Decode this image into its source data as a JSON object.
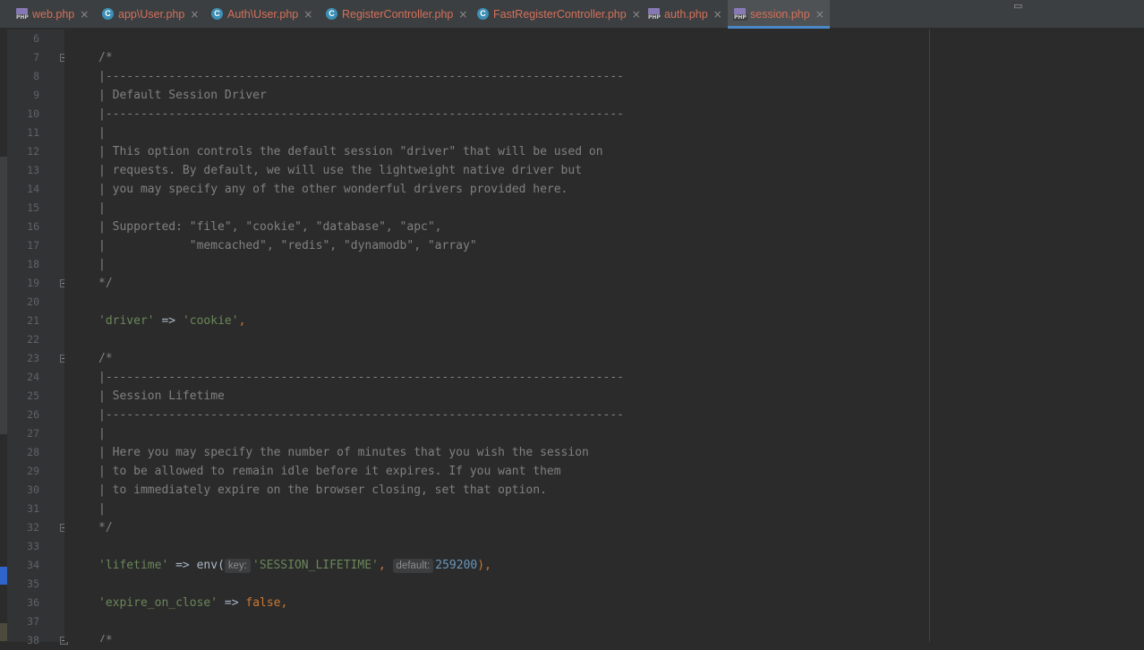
{
  "tabs": [
    {
      "label": "web.php",
      "icon": "php-file-icon"
    },
    {
      "label": "app\\User.php",
      "icon": "class-icon"
    },
    {
      "label": "Auth\\User.php",
      "icon": "class-icon"
    },
    {
      "label": "RegisterController.php",
      "icon": "class-icon"
    },
    {
      "label": "FastRegisterController.php",
      "icon": "class-icon"
    },
    {
      "label": "auth.php",
      "icon": "php-file-icon"
    },
    {
      "label": "session.php",
      "icon": "php-file-icon",
      "active": true
    }
  ],
  "close_glyph": "×",
  "line_numbers": [
    "6",
    "7",
    "8",
    "9",
    "10",
    "11",
    "12",
    "13",
    "14",
    "15",
    "16",
    "17",
    "18",
    "19",
    "20",
    "21",
    "22",
    "23",
    "24",
    "25",
    "26",
    "27",
    "28",
    "29",
    "30",
    "31",
    "32",
    "33",
    "34",
    "35",
    "36",
    "37",
    "38"
  ],
  "code": {
    "l7": "/*",
    "l8": "|--------------------------------------------------------------------------",
    "l9": "| Default Session Driver",
    "l10": "|--------------------------------------------------------------------------",
    "l11": "|",
    "l12": "| This option controls the default session \"driver\" that will be used on",
    "l13": "| requests. By default, we will use the lightweight native driver but",
    "l14": "| you may specify any of the other wonderful drivers provided here.",
    "l15": "|",
    "l16": "| Supported: \"file\", \"cookie\", \"database\", \"apc\",",
    "l17": "|            \"memcached\", \"redis\", \"dynamodb\", \"array\"",
    "l18": "|",
    "l19": "*/",
    "l21_key": "'driver'",
    "l21_arrow": " => ",
    "l21_val": "'cookie'",
    "l21_end": ",",
    "l23": "/*",
    "l24": "|--------------------------------------------------------------------------",
    "l25": "| Session Lifetime",
    "l26": "|--------------------------------------------------------------------------",
    "l27": "|",
    "l28": "| Here you may specify the number of minutes that you wish the session",
    "l29": "| to be allowed to remain idle before it expires. If you want them",
    "l30": "| to immediately expire on the browser closing, set that option.",
    "l31": "|",
    "l32": "*/",
    "l34_key": "'lifetime'",
    "l34_arrow": " => ",
    "l34_fn": "env(",
    "l34_hint_key": "key:",
    "l34_arg1": "'SESSION_LIFETIME'",
    "l34_comma": ", ",
    "l34_hint_default": "default:",
    "l34_arg2": "259200",
    "l34_end": "),",
    "l36_key": "'expire_on_close'",
    "l36_arrow": " => ",
    "l36_val": "false",
    "l36_end": ",",
    "l38": "/*"
  },
  "colors": {
    "background": "#2b2b2b",
    "gutter": "#313335",
    "comment": "#808080",
    "string": "#6a8759",
    "number": "#6897bb",
    "keyword": "#cc7832",
    "tab_text": "#d4705a",
    "tab_underline": "#4a88c7"
  }
}
